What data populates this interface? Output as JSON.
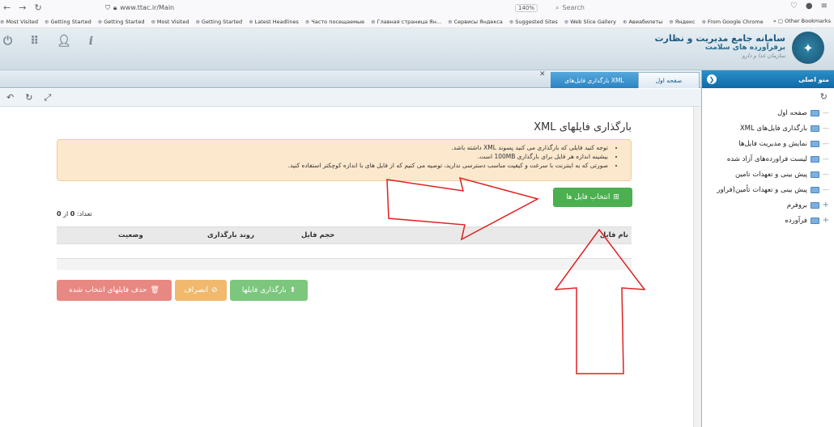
{
  "browser": {
    "url": "www.ttac.ir/Main",
    "zoom": "140%",
    "search_placeholder": "Search",
    "bookmarks": [
      "Most Visited",
      "Getting Started",
      "Getting Started",
      "Most Visited",
      "Getting Started",
      "Latest Headlines",
      "Часто посещаемые",
      "Главная страница Ян...",
      "Сервисы Яндекса",
      "Suggested Sites",
      "Web Slice Gallery",
      "Авиабилеты",
      "Яндекс",
      "From Google Chrome"
    ],
    "other_bookmarks": "Other Bookmarks"
  },
  "header": {
    "title_line1": "سامانه جامع مدیریت و نظارت",
    "title_line2": "برفرآورده های سلامت",
    "logo_caption": "سازمان غذا و دارو"
  },
  "sidebar": {
    "title": "منو اصلی",
    "items": [
      {
        "label": "صفحه اول",
        "expandable": false
      },
      {
        "label": "بارگذاری فایل‌های XML",
        "expandable": false
      },
      {
        "label": "نمایش و مدیریت فایل‌ها",
        "expandable": false
      },
      {
        "label": "لیست فراورده‌های آزاد شده",
        "expandable": false
      },
      {
        "label": "پیش بینی و تعهدات تامین",
        "expandable": false
      },
      {
        "label": "پیش بینی و تعهدات تأمین(فراور",
        "expandable": false
      },
      {
        "label": "بروفرم",
        "expandable": true
      },
      {
        "label": "فرآورده",
        "expandable": true
      }
    ]
  },
  "tabs": {
    "home": "صفحه اول",
    "xml": "بارگذاری فایل‌های XML"
  },
  "main": {
    "title": "بارگذاری فایلهای XML",
    "notes": [
      "توجه کنید فایلی که بارگذاری می کنید پسوند XML داشته باشد.",
      "بیشینه اندازه هر فایل برای بارگذاری 100MB است.",
      "صورتی که به اینترنت با سرعت و کیفیت مناسب دسترسی ندارید، توصیه می کنیم که از فایل های با اندازه کوچکتر استفاده کنید."
    ],
    "select_button": "انتخاب فایل ها",
    "count_label": "تعداد:",
    "count_value": "0",
    "count_of": "از",
    "count_total": "0",
    "columns": [
      "نام فایل",
      "حجم فایل",
      "روند بارگذاری",
      "وضعیت"
    ],
    "upload_button": "بارگذاری فایلها",
    "cancel_button": "انصراف",
    "delete_button": "حذف فایلهای انتخاب شده"
  },
  "colors": {
    "accent_blue": "#1373b0",
    "alert_bg": "#fce8cd",
    "success": "#4caf50",
    "danger": "#e88882",
    "warning": "#f0b96e",
    "annotation_red": "#e02020"
  }
}
